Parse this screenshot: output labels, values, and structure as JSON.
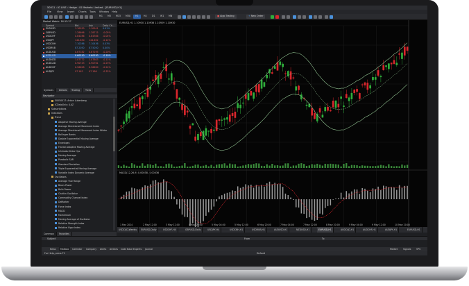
{
  "window": {
    "title": "50011 : IG LIVE : Hedge : IG Markets Limited - [EURUSD,H1]",
    "controls": [
      "–",
      "□",
      "×"
    ]
  },
  "menu": [
    "File",
    "View",
    "Insert",
    "Charts",
    "Tools",
    "Window",
    "Help"
  ],
  "toolbar": {
    "timeframes": [
      "M1",
      "M5",
      "M15",
      "M30",
      "H1",
      "H4",
      "D1",
      "W1",
      "MN"
    ],
    "algo_trading": "Algo Trading",
    "new_order": "New Order"
  },
  "market_watch": {
    "title": "Market Watch: 16:13:37",
    "columns": [
      "Symbol",
      "Bid",
      "Ask",
      "Daily Ch..."
    ],
    "rows": [
      {
        "symbol": "EURUSD",
        "bid": "1.10930",
        "ask": "1.10941",
        "change": "0.01%",
        "bid_color": "#e05555",
        "change_color": "#4a90d9"
      },
      {
        "symbol": "GBPUSD",
        "bid": "1.28696",
        "ask": "1.28715",
        "change": "-0.05%",
        "bid_color": "#e05555",
        "change_color": "#e05555"
      },
      {
        "symbol": "USDCHF",
        "bid": "0.84286",
        "ask": "0.84306",
        "change": "-0.04%",
        "bid_color": "#e05555",
        "change_color": "#e05555"
      },
      {
        "symbol": "USDJPY",
        "bid": "144.630",
        "ask": "144.652",
        "change": "-0.12%",
        "bid_color": "#e05555",
        "change_color": "#e05555"
      },
      {
        "symbol": "USDCNH",
        "bid": "7.10286",
        "ask": "7.10436",
        "change": "0.03%",
        "bid_color": "#4a90d9",
        "change_color": "#4a90d9"
      },
      {
        "symbol": "USDRUB",
        "bid": "87.2050",
        "ask": "87.5050",
        "change": "0.00%",
        "bid_color": "#4a90d9",
        "change_color": "#4a90d9"
      },
      {
        "symbol": "AUDUSD",
        "bid": "0.67182",
        "ask": "0.67195",
        "change": "-0.20%",
        "bid_color": "#e05555",
        "change_color": "#e05555"
      },
      {
        "symbol": "NZDUSD",
        "bid": "0.60510",
        "ask": "0.60530",
        "change": "-0.10%",
        "bid_color": "#ffffff",
        "change_color": "#ffffff"
      },
      {
        "symbol": "AUDNZD",
        "bid": "1.07772",
        "ask": "1.07803",
        "change": "-0.11%",
        "bid_color": "#e05555",
        "change_color": "#e05555"
      },
      {
        "symbol": "AUDCAD",
        "bid": "0.90743",
        "ask": "0.90761",
        "change": "-0.23%",
        "bid_color": "#e05555",
        "change_color": "#e05555"
      },
      {
        "symbol": "AUDCHF",
        "bid": "0.56628",
        "ask": "0.56650",
        "change": "-0.24%",
        "bid_color": "#e05555",
        "change_color": "#e05555"
      },
      {
        "symbol": "AUDJPY",
        "bid": "97.163",
        "ask": "97.186",
        "change": "-0.32%",
        "bid_color": "#e05555",
        "change_color": "#e05555"
      }
    ],
    "selected_index": 7,
    "tabs": [
      "Symbols",
      "Details",
      "Trading",
      "Ticks"
    ]
  },
  "navigator": {
    "title": "Navigator",
    "items": [
      {
        "label": "50050017: Anton Lubenberg",
        "level": 2
      },
      {
        "label": "ICDataOnly: ILAZ",
        "level": 2
      },
      {
        "label": "Subscriptions",
        "level": 1
      },
      {
        "label": "Indicators",
        "level": 1
      },
      {
        "label": "Trend",
        "level": 2
      },
      {
        "label": "Adaptive Moving Average",
        "level": 3
      },
      {
        "label": "Average Directional Movement Index",
        "level": 3
      },
      {
        "label": "Average Directional Movement Index Wilder",
        "level": 3
      },
      {
        "label": "Bollinger Bands",
        "level": 3
      },
      {
        "label": "Double Exponential Moving Average",
        "level": 3
      },
      {
        "label": "Envelopes",
        "level": 3
      },
      {
        "label": "Fractal Adaptive Moving Average",
        "level": 3
      },
      {
        "label": "Ichimoku Kinko Hyo",
        "level": 3
      },
      {
        "label": "Moving Average",
        "level": 3
      },
      {
        "label": "Parabolic SAR",
        "level": 3
      },
      {
        "label": "Standard Deviation",
        "level": 3
      },
      {
        "label": "Triple Exponential Moving Average",
        "level": 3
      },
      {
        "label": "Variable Index Dynamic Average",
        "level": 3
      },
      {
        "label": "Oscillators",
        "level": 2
      },
      {
        "label": "Average True Range",
        "level": 3
      },
      {
        "label": "Bears Power",
        "level": 3
      },
      {
        "label": "Bulls Power",
        "level": 3
      },
      {
        "label": "Chaikin Oscillator",
        "level": 3
      },
      {
        "label": "Commodity Channel Index",
        "level": 3
      },
      {
        "label": "DeMarker",
        "level": 3
      },
      {
        "label": "Force Index",
        "level": 3
      },
      {
        "label": "MACD",
        "level": 3
      },
      {
        "label": "Momentum",
        "level": 3
      },
      {
        "label": "Moving Average of Oscillator",
        "level": 3
      },
      {
        "label": "Relative Strength Index",
        "level": 3
      },
      {
        "label": "Relative Vigor Index",
        "level": 3
      }
    ],
    "bottom_tabs": [
      "Common",
      "Favorites"
    ]
  },
  "chart": {
    "header": "EURUSD,H1  1.10930 1.10936 1.10929 1.10930",
    "indicator_label": "MACD(12,26,9) 0.00038 -0.00036",
    "tabs": [
      "USDCAD,Weekly",
      "EURUSD,Daily",
      "USDCHF,H4",
      "GBPUSD,Daily",
      "USDJPY,H4",
      "USDCNH,H1",
      "USDRUB,H1",
      "AUDUSD,H1",
      "NZDUSD,H1",
      "EURUSD,H1",
      "AUDCAD,H1",
      "AUDCHF,H1",
      "AUDJPY,H1",
      "EURUSD,H1"
    ],
    "active_tab": 9,
    "time_labels": [
      "1 Mar 2024",
      "2 May 12:00",
      "3 May 12:00",
      "4 May 20:00",
      "5 May 04:00",
      "5 May 12:00",
      "6 May 20:00",
      "7 May 04:00",
      "7 May 12:00",
      "8 May 20:00",
      "9 May 04:00",
      "9 May 12:00",
      "10 May 20:00"
    ],
    "colors": {
      "bull": "#2fae3c",
      "bear": "#d9262c",
      "bands": "#8fbf8f",
      "macd_hist": "#9a9a9a",
      "signal": "#d9262c"
    }
  },
  "toolbox": {
    "columns": [
      "Subject",
      "From",
      "To"
    ],
    "tabs": [
      "News",
      "Mailbox",
      "Calendar",
      "Company",
      "Alerts",
      "Articles",
      "Code Base",
      "Experts",
      "Journal"
    ],
    "active_tab": 1,
    "right_items": [
      "Market",
      "Signals",
      "VPS"
    ]
  },
  "statusbar": {
    "help": "For Help, press F1",
    "profile": "Default"
  }
}
